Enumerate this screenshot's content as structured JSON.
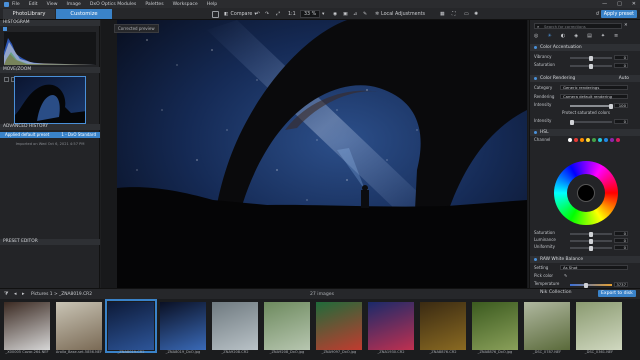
{
  "menubar": {
    "items": [
      "File",
      "Edit",
      "View",
      "Image",
      "DxO Optics Modules",
      "Palettes",
      "Workspace",
      "Help"
    ],
    "window_buttons": [
      "—",
      "□",
      "✕"
    ]
  },
  "tabs": {
    "photolibrary": "PhotoLibrary",
    "customize": "Customize"
  },
  "toolbar": {
    "compare": "Compare",
    "zoom": "33 %",
    "local_adjustments": "Local Adjustments",
    "reset": "Reset",
    "apply_preset": "Apply preset"
  },
  "left": {
    "histogram_title": "HISTOGRAM",
    "movezoom_title": "MOVE/ZOOM",
    "advanced_history_title": "ADVANCED HISTORY",
    "history_entry_left": "Applied default preset",
    "history_entry_right": "1 - DxO Standard",
    "history_note": "Imported on Wed Oct 6, 2021 4:57 PM",
    "preset_editor_title": "PRESET EDITOR"
  },
  "viewer": {
    "label": "Corrected preview"
  },
  "right": {
    "search_placeholder": "Search for corrections",
    "color_accentuation": "Color Accentuation",
    "vibrancy": {
      "label": "Vibrancy",
      "value": "0"
    },
    "saturation": {
      "label": "Saturation",
      "value": "0"
    },
    "color_rendering": "Color Rendering",
    "color_rendering_mode": "Auto",
    "category": {
      "label": "Category",
      "value": "Generic renderings"
    },
    "rendering": {
      "label": "Rendering",
      "value": "Camera default rendering"
    },
    "intensity": {
      "label": "Intensity",
      "value": "100"
    },
    "protect_saturated": "Protect saturated colors",
    "intensity2": {
      "label": "Intensity",
      "value": "0"
    },
    "hsl": "HSL",
    "channel": "Channel",
    "hsl_saturation": {
      "label": "Saturation",
      "value": "0"
    },
    "luminance": {
      "label": "Luminance",
      "value": "0"
    },
    "uniformity": {
      "label": "Uniformity",
      "value": "0"
    },
    "raw_white_balance": "RAW White Balance",
    "setting": {
      "label": "Setting",
      "value": "As Shot"
    },
    "pick_color": "Pick color",
    "temperature": {
      "label": "Temperature",
      "value": "3737"
    },
    "swatch_colors": [
      "#ffffff",
      "#e53935",
      "#fb8c00",
      "#fdd835",
      "#43a047",
      "#26c6da",
      "#1e88e5",
      "#8e24aa",
      "#d81b60"
    ]
  },
  "filmstrip": {
    "path": "Pictures 1 > _ZNA8019.CR2",
    "count": "27 images",
    "nik": "Nik Collection",
    "export": "Export to disk",
    "thumbs": [
      "_X00005 Cozar-264.NEF",
      "Arolla_Base-set-5856.NEF",
      "_ZNA8019.CR2",
      "_ZNA8019_DxO.jpg",
      "_ZNA9208.CR2",
      "_ZNA9208_DxO.jpg",
      "_ZNA9097_DxO.jpg",
      "_ZNA1930.CR2",
      "_ZNA8876.CR2",
      "_ZNA8876_DxO.jpg",
      "_DSC_0787.NEF",
      "_DSC_0361.NEF"
    ]
  }
}
